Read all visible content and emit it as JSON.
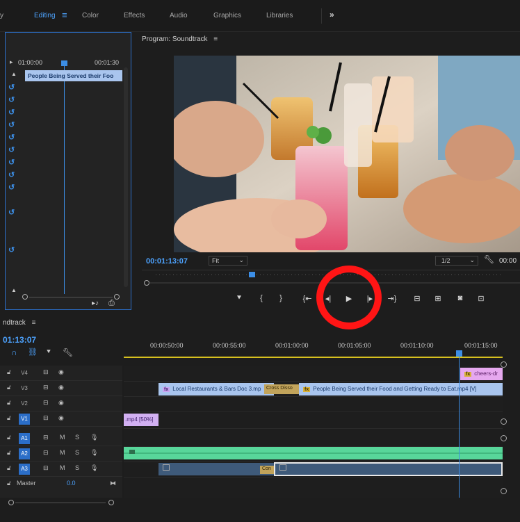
{
  "workspaces": {
    "editing": "Editing",
    "color": "Color",
    "effects": "Effects",
    "audio": "Audio",
    "graphics": "Graphics",
    "libraries": "Libraries",
    "more": "»"
  },
  "source": {
    "ruler_start": "01:00:00",
    "ruler_end": "00:01:30",
    "clip_label": "People Being Served their Foo"
  },
  "program": {
    "title": "Program: Soundtrack",
    "menu_glyph": "≡",
    "timecode": "00:01:13:07",
    "fit": "Fit",
    "resolution": "1/2",
    "timecode_right": "00:00"
  },
  "timeline": {
    "title": "ndtrack",
    "menu_glyph": "≡",
    "timecode": "01:13:07",
    "times": [
      "00:00:50:00",
      "00:00:55:00",
      "00:01:00:00",
      "00:01:05:00",
      "00:01:10:00",
      "00:01:15:00"
    ],
    "tracks": [
      {
        "label": "V4"
      },
      {
        "label": "V3"
      },
      {
        "label": "V2"
      },
      {
        "label": "V1"
      },
      {
        "label": "A1"
      },
      {
        "label": "A2"
      },
      {
        "label": "A3"
      }
    ],
    "master_label": "Master",
    "master_value": "0.0",
    "mute": "M",
    "solo": "S",
    "clips": {
      "v4_label": "cheers-dr",
      "v3_a": "Local Restaurants & Bars Doc 3.mp",
      "v3_b": "Cross Disso",
      "v3_c": "People Being Served their Food and Getting Ready to Eat.mp4 [V]",
      "v1_label": ".mp4 [50%]",
      "a3_label": "Con"
    },
    "fx_badge": "fx"
  },
  "colors": {
    "accent": "#4da3ff",
    "clip_blue": "#a9c5ee",
    "clip_purple": "#c9a3f0",
    "audio_green": "#58d69a",
    "highlight_red": "#ff1515"
  }
}
